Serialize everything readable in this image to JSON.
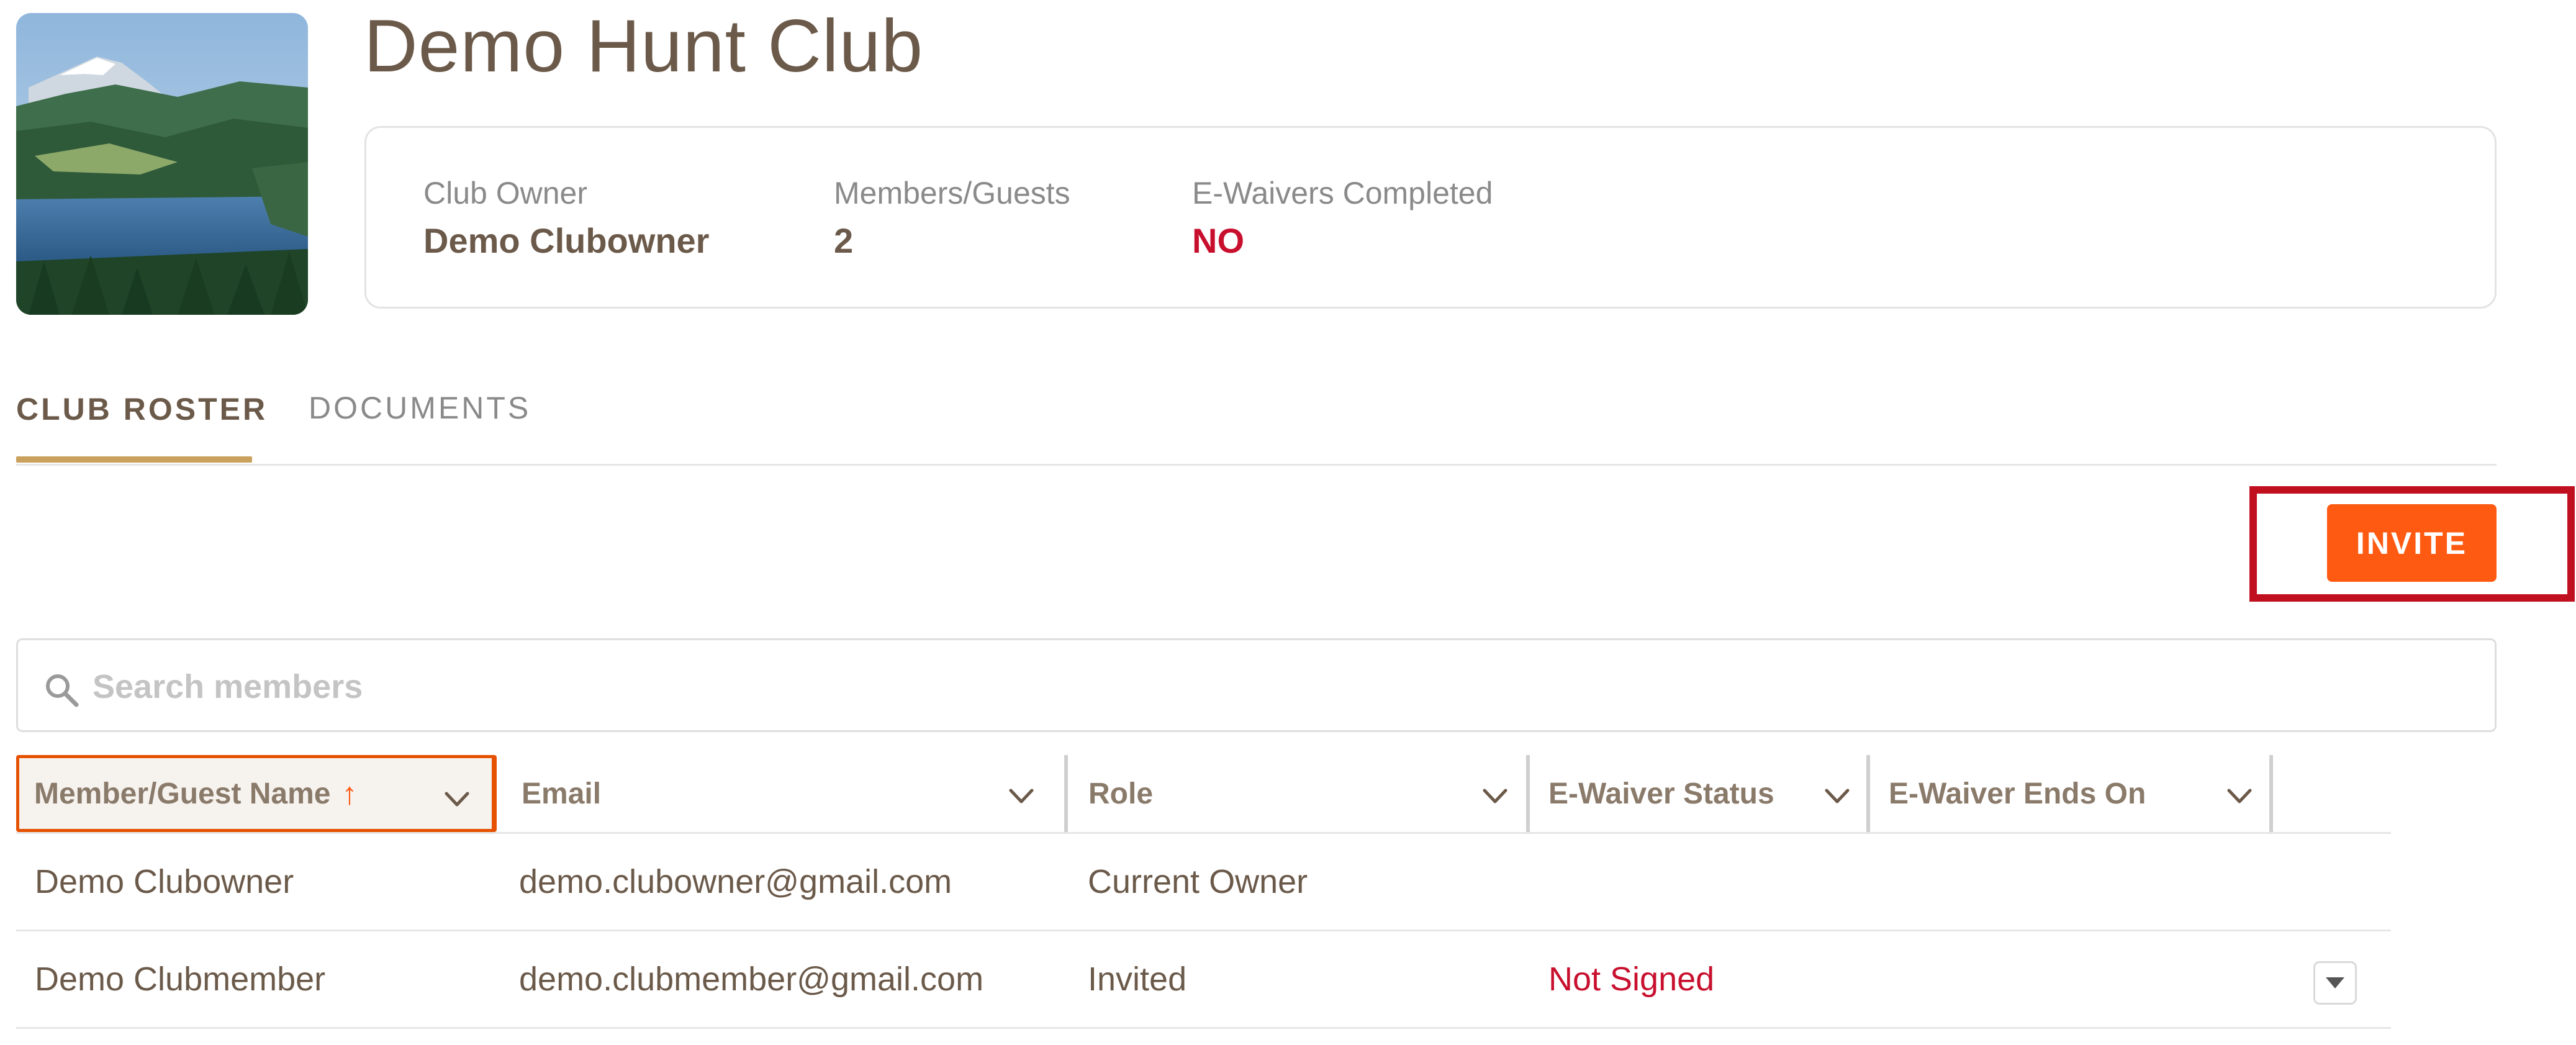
{
  "club": {
    "title": "Demo Hunt Club",
    "image_description": "lake-mountain-photo"
  },
  "stats": {
    "owner_label": "Club Owner",
    "owner_value": "Demo Clubowner",
    "members_label": "Members/Guests",
    "members_value": "2",
    "waivers_label": "E-Waivers Completed",
    "waivers_value": "NO"
  },
  "tabs": [
    {
      "label": "CLUB ROSTER",
      "active": true
    },
    {
      "label": "DOCUMENTS",
      "active": false
    }
  ],
  "actions": {
    "invite_label": "INVITE"
  },
  "search": {
    "placeholder": "Search members",
    "value": ""
  },
  "table": {
    "columns": [
      {
        "label": "Member/Guest Name",
        "sorted": "ascending"
      },
      {
        "label": "Email"
      },
      {
        "label": "Role"
      },
      {
        "label": "E-Waiver Status"
      },
      {
        "label": "E-Waiver Ends On"
      }
    ],
    "rows": [
      {
        "name": "Demo Clubowner",
        "email": "demo.clubowner@gmail.com",
        "role": "Current Owner",
        "waiver_status": "",
        "waiver_ends": ""
      },
      {
        "name": "Demo Clubmember",
        "email": "demo.clubmember@gmail.com",
        "role": "Invited",
        "waiver_status": "Not Signed",
        "waiver_ends": ""
      }
    ]
  },
  "colors": {
    "accent": "#ff5a12",
    "alert": "#c8102e",
    "tab_underline": "#c9a15c",
    "text": "#6b5a4a"
  }
}
